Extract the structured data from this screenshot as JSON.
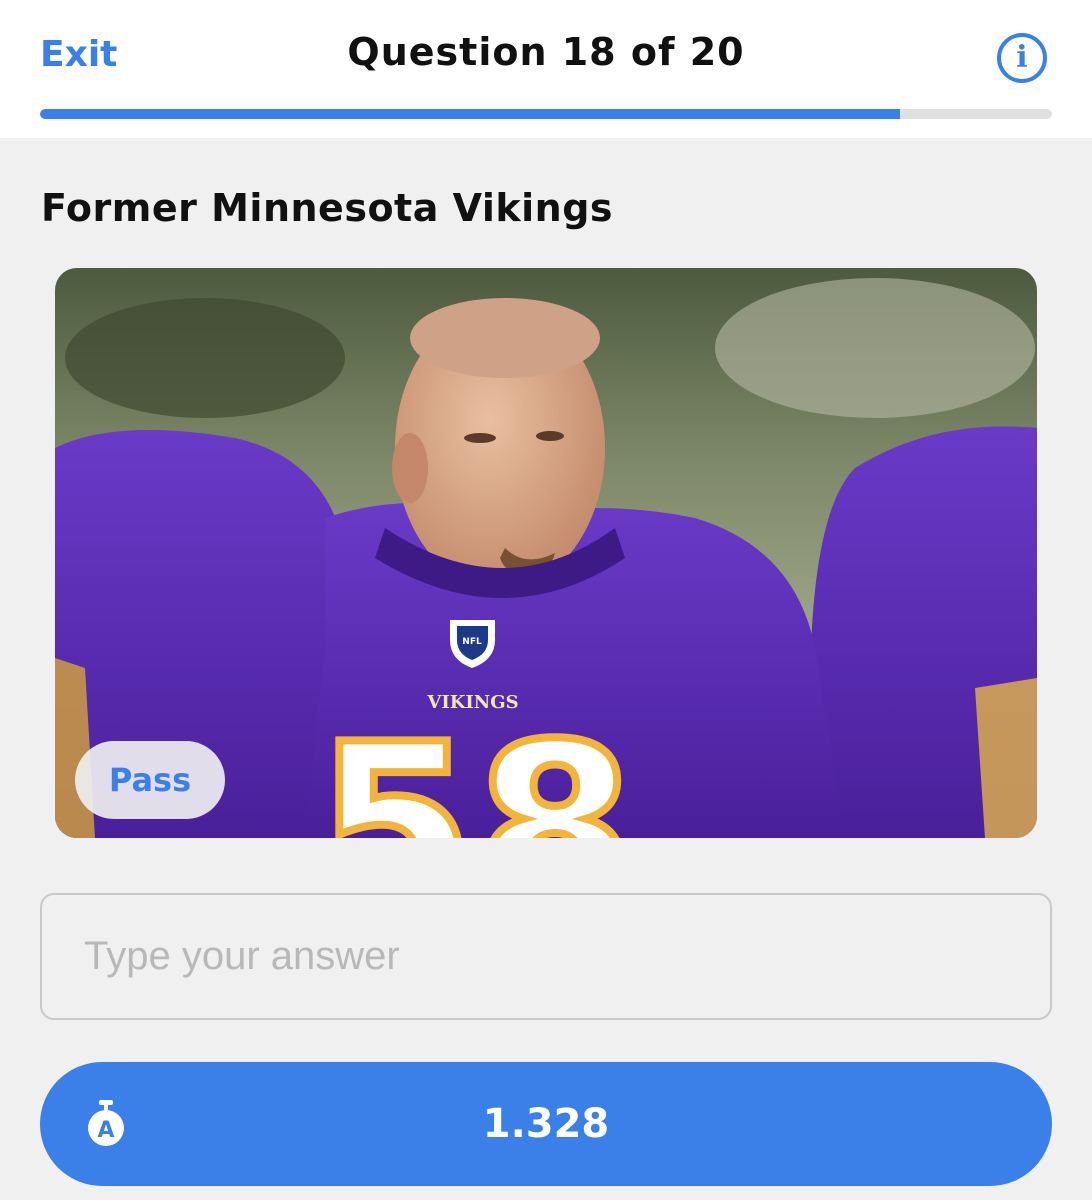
{
  "header": {
    "exit_label": "Exit",
    "question_title": "Question 18 of 20",
    "info_icon": "info-icon"
  },
  "progress": {
    "current": 18,
    "total": 20,
    "fraction": 0.85,
    "color": "#3b7fe8"
  },
  "question": {
    "category": "Former Minnesota Vikings",
    "jersey_text": "VIKINGS",
    "jersey_number": "58"
  },
  "pass_label": "Pass",
  "answer": {
    "placeholder": "Type your answer",
    "value": ""
  },
  "timer": {
    "value": "1.328",
    "icon": "stopwatch-icon"
  },
  "colors": {
    "accent": "#3b7fe8",
    "background": "#f0f0f0"
  }
}
